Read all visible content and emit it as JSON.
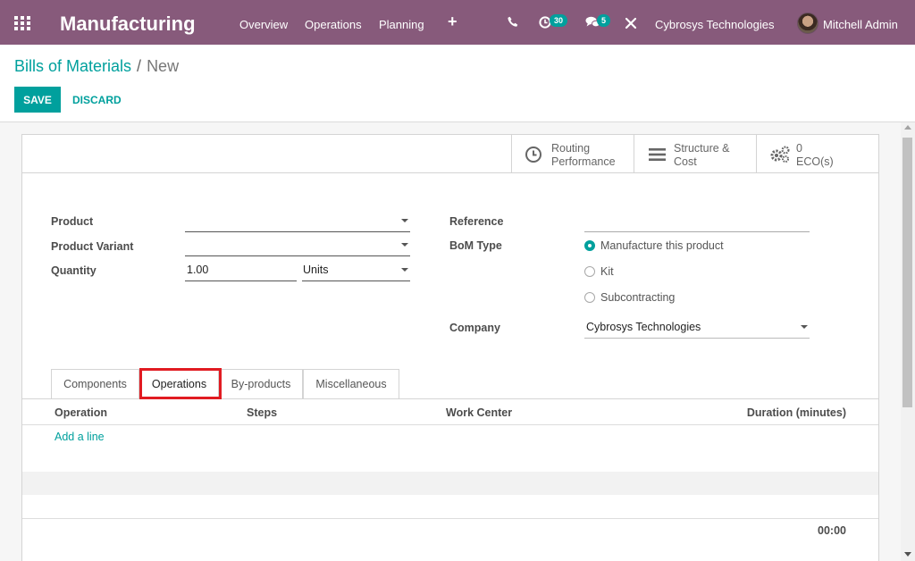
{
  "navbar": {
    "app_name": "Manufacturing",
    "menu": [
      "Overview",
      "Operations",
      "Planning"
    ],
    "activity_count": "30",
    "message_count": "5",
    "company": "Cybrosys Technologies",
    "user": "Mitchell Admin"
  },
  "breadcrumb": {
    "parent": "Bills of Materials",
    "separator": "/",
    "current": "New"
  },
  "buttons": {
    "save": "SAVE",
    "discard": "DISCARD"
  },
  "smart_buttons": [
    {
      "line1": "Routing",
      "line2": "Performance",
      "icon": "clock-icon"
    },
    {
      "line1": "Structure &",
      "line2": "Cost",
      "icon": "bars-icon"
    },
    {
      "line1": "0",
      "line2": "ECO(s)",
      "icon": "gears-icon"
    }
  ],
  "form": {
    "product_label": "Product",
    "product_value": "",
    "variant_label": "Product Variant",
    "variant_value": "",
    "quantity_label": "Quantity",
    "quantity_value": "1.00",
    "uom_value": "Units",
    "reference_label": "Reference",
    "reference_value": "",
    "bom_type_label": "BoM Type",
    "bom_type_options": [
      "Manufacture this product",
      "Kit",
      "Subcontracting"
    ],
    "bom_type_selected": "Manufacture this product",
    "company_label": "Company",
    "company_value": "Cybrosys Technologies"
  },
  "tabs": [
    "Components",
    "Operations",
    "By-products",
    "Miscellaneous"
  ],
  "active_tab": "Operations",
  "table": {
    "columns": [
      "Operation",
      "Steps",
      "Work Center",
      "Duration (minutes)"
    ],
    "add_line": "Add a line",
    "total_duration": "00:00"
  },
  "colors": {
    "navbar": "#875a7b",
    "accent": "#00a09d",
    "highlight": "#e11b22"
  }
}
